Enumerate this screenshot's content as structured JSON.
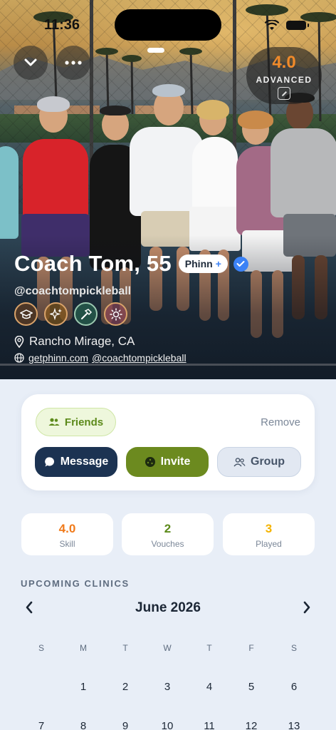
{
  "status": {
    "time": "11:36"
  },
  "hero": {
    "level_value": "4.0",
    "level_label": "ADVANCED",
    "name": "Coach Tom, 55",
    "pill_label": "Phinn",
    "pill_plus": "+",
    "handle": "@coachtompickleball",
    "location": "Rancho Mirage, CA",
    "links": [
      "getphinn.com",
      "@coachtompickleball"
    ],
    "achievement_icons": [
      "graduation-cap-icon",
      "sparkles-icon",
      "hammer-icon",
      "sun-icon"
    ]
  },
  "actions": {
    "friends_label": "Friends",
    "remove_label": "Remove",
    "message_label": "Message",
    "invite_label": "Invite",
    "group_label": "Group"
  },
  "stats": [
    {
      "value": "4.0",
      "label": "Skill",
      "color": "#f07a1a"
    },
    {
      "value": "2",
      "label": "Vouches",
      "color": "#5c8a1a"
    },
    {
      "value": "3",
      "label": "Played",
      "color": "#f5b400"
    }
  ],
  "calendar": {
    "section_title": "UPCOMING CLINICS",
    "month": "June 2026",
    "weekdays": [
      "S",
      "M",
      "T",
      "W",
      "T",
      "F",
      "S"
    ],
    "week1": [
      "",
      "1",
      "2",
      "3",
      "4",
      "5",
      "6"
    ],
    "week2": [
      "7",
      "8",
      "9",
      "10",
      "11",
      "12",
      "13"
    ]
  },
  "colors": {
    "accent_orange": "#f08a2a",
    "navy": "#1c3352",
    "olive": "#6c8a1f",
    "friends_green": "#5c8a1a",
    "background": "#e8eef7"
  }
}
